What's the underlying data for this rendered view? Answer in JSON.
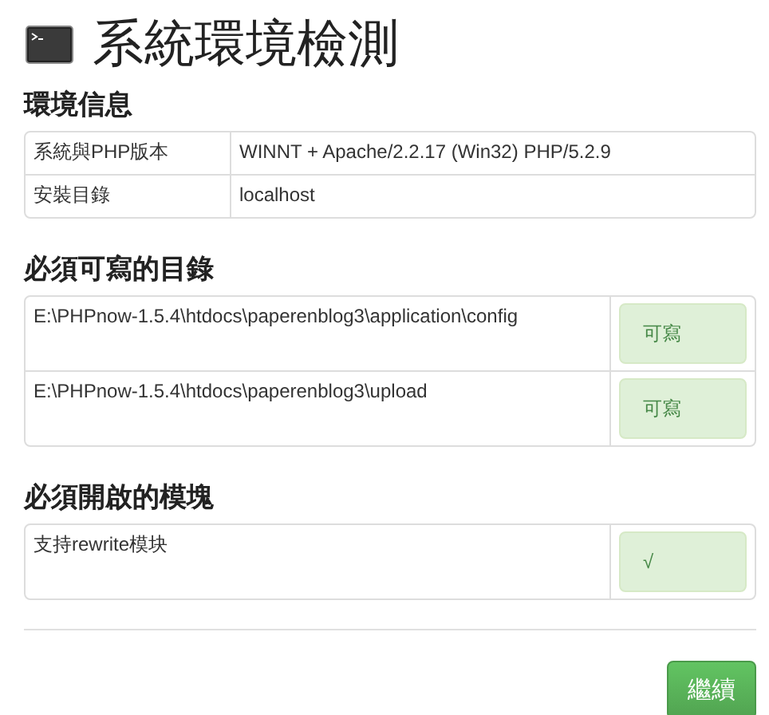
{
  "title": "系統環境檢測",
  "env": {
    "heading": "環境信息",
    "rows": [
      {
        "label": "系統與PHP版本",
        "value": "WINNT + Apache/2.2.17 (Win32) PHP/5.2.9"
      },
      {
        "label": "安裝目錄",
        "value": "localhost"
      }
    ]
  },
  "dirs": {
    "heading": "必須可寫的目錄",
    "rows": [
      {
        "path": "E:\\PHPnow-1.5.4\\htdocs\\paperenblog3\\application\\config",
        "status": "可寫",
        "ok": true
      },
      {
        "path": "E:\\PHPnow-1.5.4\\htdocs\\paperenblog3\\upload",
        "status": "可寫",
        "ok": true
      }
    ]
  },
  "modules": {
    "heading": "必須開啟的模塊",
    "rows": [
      {
        "name": "支持rewrite模块",
        "status": "√",
        "ok": true
      }
    ]
  },
  "button": "繼續"
}
